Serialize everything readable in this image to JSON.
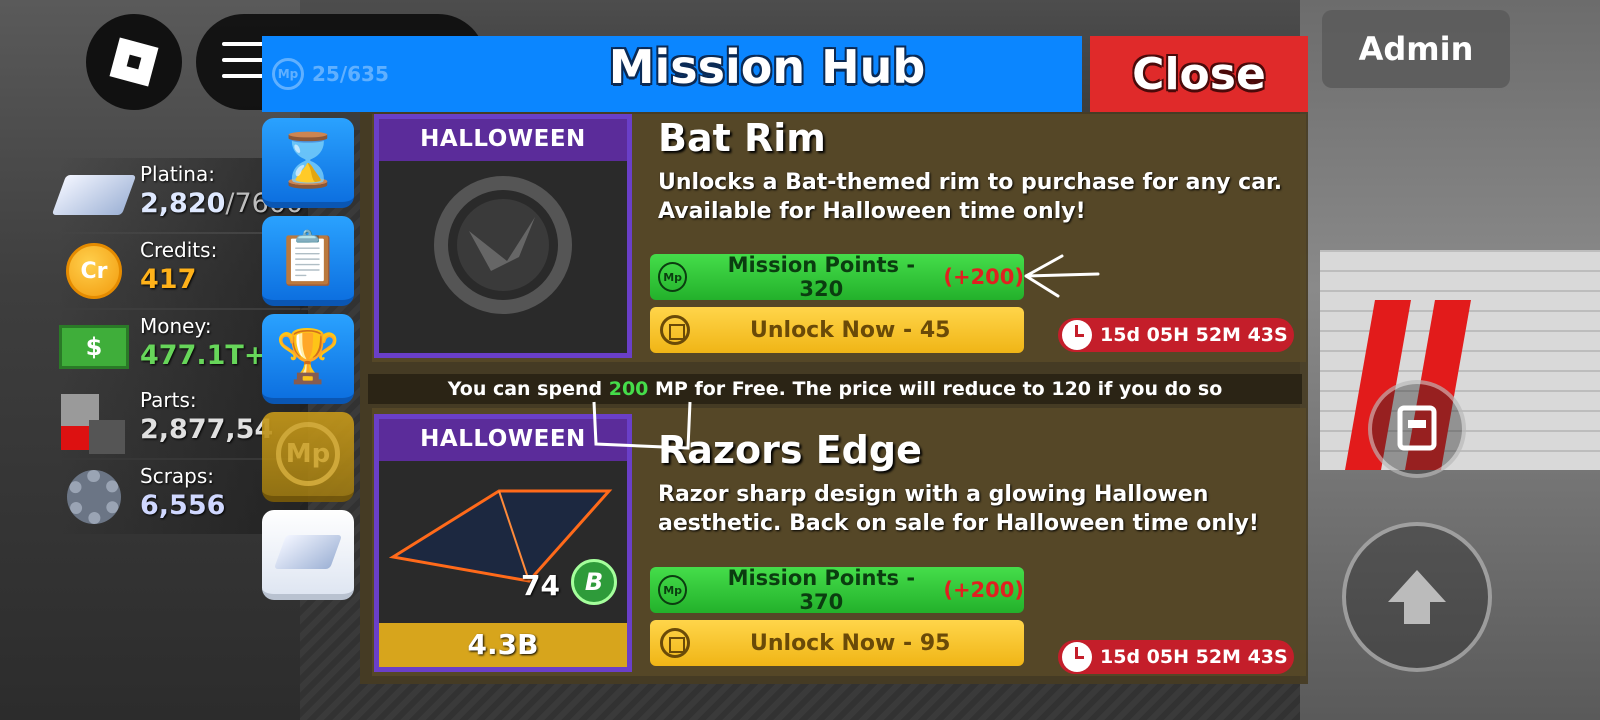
{
  "hub": {
    "title": "Mission Hub",
    "close_label": "Close",
    "mp_counter": "25/635"
  },
  "admin_label": "Admin",
  "currencies": [
    {
      "label": "Platina:",
      "value": "2,820",
      "max": "/7600",
      "icon": "platina-bars-icon"
    },
    {
      "label": "Credits:",
      "value": "417",
      "icon": "credits-coin-icon",
      "coin_text": "Cr"
    },
    {
      "label": "Money:",
      "value": "477.1T+",
      "icon": "money-bill-icon",
      "bill_text": "$"
    },
    {
      "label": "Parts:",
      "value": "2,877,54",
      "icon": "parts-cubes-icon"
    },
    {
      "label": "Scraps:",
      "value": "6,556",
      "icon": "scraps-gear-icon"
    }
  ],
  "tabs": [
    {
      "name": "hourglass",
      "icon": "⌛"
    },
    {
      "name": "clipboard",
      "icon": "📋"
    },
    {
      "name": "trophy",
      "icon": "🏆"
    },
    {
      "name": "mission-points",
      "icon": "Mp"
    },
    {
      "name": "platina",
      "icon": "platina-bars-icon"
    }
  ],
  "items": [
    {
      "category": "HALLOWEEN",
      "title": "Bat Rim",
      "description": "Unlocks a Bat-themed rim to purchase for any car. Available for Halloween time only!",
      "mp_icon": "Mp",
      "mp_label": "Mission Points - 320",
      "mp_bonus": "(+200)",
      "unlock_label": "Unlock Now - 45",
      "timer": "15d 05H 52M 43S"
    },
    {
      "category": "HALLOWEEN",
      "title": "Razors Edge",
      "description": "Razor sharp design with a glowing Hallowen aesthetic. Back on sale for Halloween time only!",
      "mp_icon": "Mp",
      "mp_label": "Mission Points - 370",
      "mp_bonus": "(+200)",
      "unlock_label": "Unlock Now - 95",
      "timer": "15d 05H 52M 43S",
      "tier": "74",
      "badge": "B",
      "price": "4.3B"
    }
  ],
  "info": {
    "prefix": "You can spend ",
    "amount": "200",
    "middle": " MP for Free. The price will reduce to ",
    "reduced": "120",
    "suffix": " if you do so"
  },
  "colors": {
    "header_blue": "#0b86ff",
    "close_red": "#e02a2a",
    "mp_green": "#23b12b",
    "unlock_gold": "#f0b516",
    "category_purple": "#5b2c9a",
    "timer_red": "#c41e2a"
  }
}
